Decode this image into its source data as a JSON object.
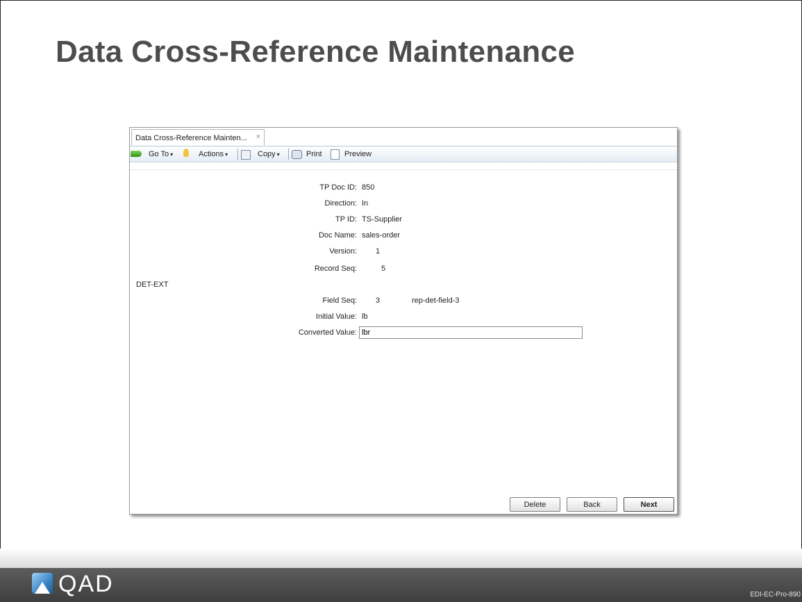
{
  "slide": {
    "title": "Data Cross-Reference Maintenance",
    "footer_code": "EDI-EC-Pro-890",
    "logo_text": "QAD"
  },
  "window": {
    "tab_label": "Data Cross-Reference Mainten...",
    "tab_close": "×",
    "toolbar": {
      "goto": "Go To",
      "actions": "Actions",
      "copy": "Copy",
      "print": "Print",
      "preview": "Preview",
      "dropdown_arrow": "▾"
    }
  },
  "form": {
    "tp_doc_id": {
      "label": "TP Doc ID:",
      "value": "850"
    },
    "direction": {
      "label": "Direction:",
      "value": "In"
    },
    "tp_id": {
      "label": "TP ID:",
      "value": "TS-Supplier"
    },
    "doc_name": {
      "label": "Doc Name:",
      "value": "sales-order"
    },
    "version": {
      "label": "Version:",
      "value": "1"
    },
    "record_seq": {
      "label": "Record Seq:",
      "value": "5"
    },
    "section": "DET-EXT",
    "field_seq": {
      "label": "Field Seq:",
      "value": "3",
      "field_name": "rep-det-field-3"
    },
    "initial_value": {
      "label": "Initial Value:",
      "value": "lb"
    },
    "converted_value": {
      "label": "Converted Value:",
      "value": "lbr"
    }
  },
  "buttons": {
    "delete": "Delete",
    "back": "Back",
    "next": "Next"
  },
  "colors": {
    "title": "#4d4d4d",
    "footer_bar": "#4a4a4a",
    "toolbar_gradient_end": "#e4ecf6"
  }
}
